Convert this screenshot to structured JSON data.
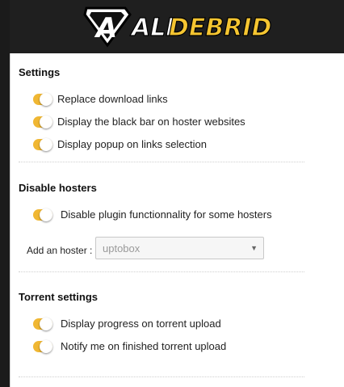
{
  "header": {
    "logo_text_a": "ALL",
    "logo_text_b": "DEBRID",
    "colors": {
      "background": "#1f1f1f",
      "logo_white": "#ffffff",
      "logo_yellow": "#f5c531"
    }
  },
  "settings": {
    "title": "Settings",
    "options": [
      {
        "label": "Replace download links",
        "enabled": true
      },
      {
        "label": "Display the black bar on hoster websites",
        "enabled": true
      },
      {
        "label": "Display popup on links selection",
        "enabled": true
      }
    ]
  },
  "disable_hosters": {
    "title": "Disable hosters",
    "option": {
      "label": "Disable plugin functionnality for some hosters",
      "enabled": true
    },
    "add_label": "Add an hoster :",
    "select_value": "uptobox"
  },
  "torrent": {
    "title": "Torrent settings",
    "options": [
      {
        "label": "Display progress on torrent upload",
        "enabled": true
      },
      {
        "label": "Notify me on finished torrent upload",
        "enabled": true
      }
    ]
  },
  "accent_color": "#f0b733"
}
